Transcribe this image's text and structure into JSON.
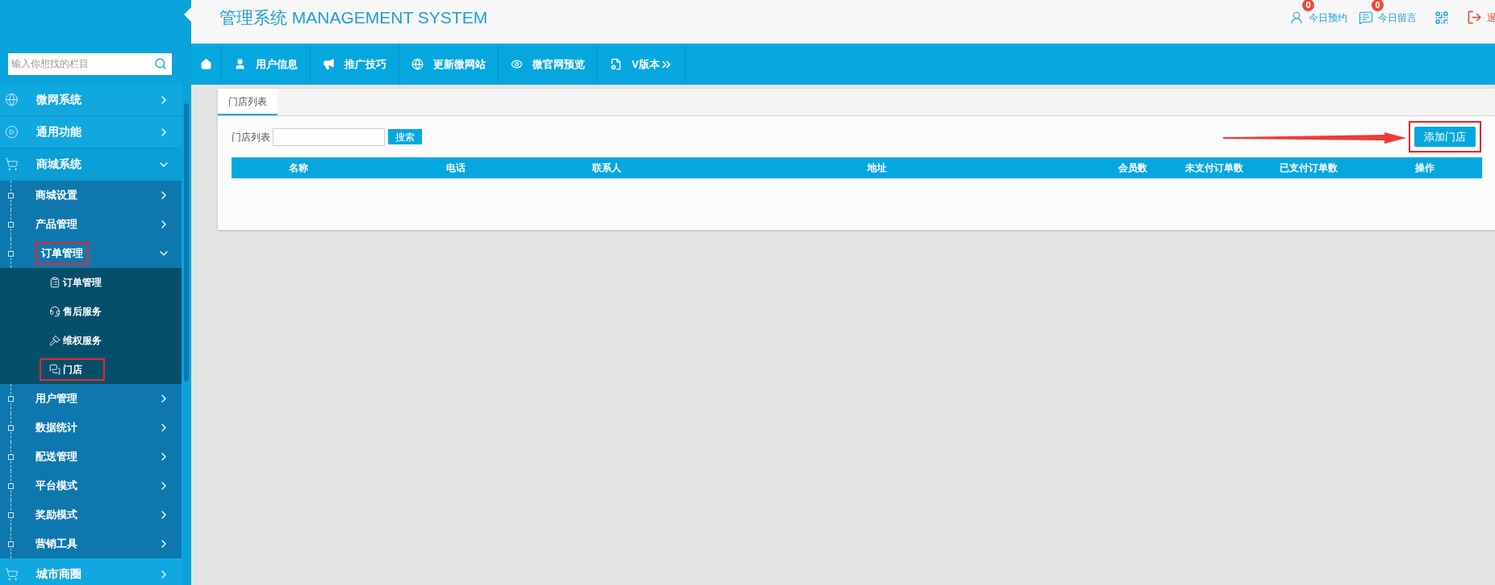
{
  "sidebar": {
    "search": {
      "placeholder": "输入你想找的栏目"
    },
    "menu": [
      {
        "label": "微网系统",
        "kind": "globe",
        "expanded": false
      },
      {
        "label": "通用功能",
        "kind": "play",
        "expanded": false
      },
      {
        "label": "商城系统",
        "kind": "cart",
        "expanded": true,
        "children": [
          {
            "label": "商城设置",
            "expanded": false,
            "highlighted": false
          },
          {
            "label": "产品管理",
            "expanded": false,
            "highlighted": false
          },
          {
            "label": "订单管理",
            "expanded": true,
            "highlighted": true,
            "children": [
              {
                "label": "订单管理",
                "kind": "clipboard",
                "highlighted": false
              },
              {
                "label": "售后服务",
                "kind": "headset",
                "highlighted": false
              },
              {
                "label": "维权服务",
                "kind": "gavel",
                "highlighted": false
              },
              {
                "label": "门店",
                "kind": "chat",
                "highlighted": true
              }
            ]
          },
          {
            "label": "用户管理",
            "expanded": false,
            "highlighted": false
          },
          {
            "label": "数据统计",
            "expanded": false,
            "highlighted": false
          },
          {
            "label": "配送管理",
            "expanded": false,
            "highlighted": false
          },
          {
            "label": "平台模式",
            "expanded": false,
            "highlighted": false
          },
          {
            "label": "奖励模式",
            "expanded": false,
            "highlighted": false
          },
          {
            "label": "营销工具",
            "expanded": false,
            "highlighted": false
          }
        ]
      },
      {
        "label": "城市商圈",
        "kind": "cart",
        "expanded": false
      }
    ]
  },
  "header": {
    "title": "管理系统 MANAGEMENT SYSTEM",
    "actions": [
      {
        "kind": "appointments",
        "label": "今日预约",
        "badge": "0"
      },
      {
        "kind": "messages",
        "label": "今日留言",
        "badge": "0"
      },
      {
        "kind": "qr"
      },
      {
        "kind": "logout",
        "label": "退"
      }
    ]
  },
  "nav": [
    {
      "kind": "home"
    },
    {
      "kind": "user",
      "label": "用户信息"
    },
    {
      "kind": "megaphone",
      "label": "推广技巧"
    },
    {
      "kind": "globe",
      "label": "更新微网站"
    },
    {
      "kind": "eye",
      "label": "微官网预览"
    },
    {
      "kind": "file",
      "label": "V版本"
    }
  ],
  "panel": {
    "tabs": [
      {
        "label": "门店列表",
        "selected": true
      }
    ],
    "filter": {
      "label": "门店列表",
      "search_button": "搜索"
    },
    "add_button": {
      "label": "添加门店",
      "highlighted": true
    },
    "table": {
      "columns": [
        "名称",
        "电话",
        "联系人",
        "地址",
        "会员数",
        "未支付订单数",
        "已支付订单数",
        "操作"
      ]
    }
  }
}
